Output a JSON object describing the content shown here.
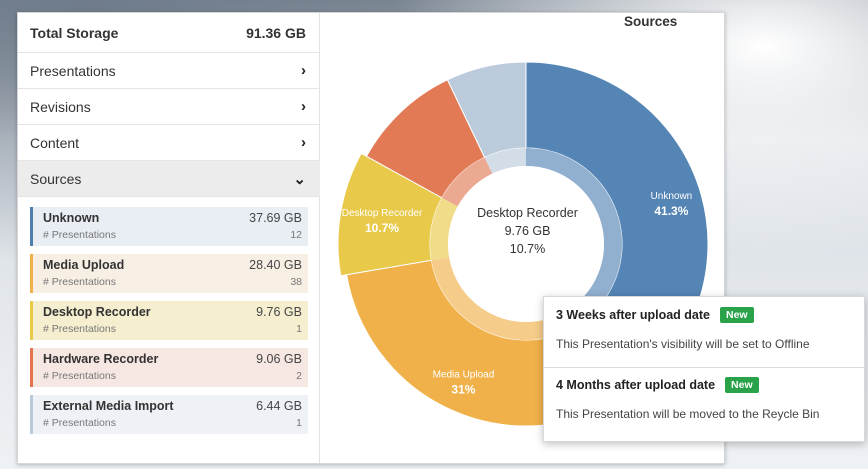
{
  "storage": {
    "total_label": "Total Storage",
    "total_value": "91.36 GB",
    "sections": [
      {
        "label": "Presentations",
        "icon": "chevron-right-icon"
      },
      {
        "label": "Revisions",
        "icon": "chevron-right-icon"
      },
      {
        "label": "Content",
        "icon": "chevron-right-icon"
      },
      {
        "label": "Sources",
        "icon": "chevron-down-icon"
      }
    ],
    "items": [
      {
        "name": "Unknown",
        "value": "37.69 GB",
        "sub_label": "# Presentations",
        "count": "12",
        "color": "#4e7fae",
        "bg": "#e9eef4"
      },
      {
        "name": "Media Upload",
        "value": "28.40 GB",
        "sub_label": "# Presentations",
        "count": "38",
        "color": "#f0b14a",
        "bg": "#f7efe4"
      },
      {
        "name": "Desktop Recorder",
        "value": "9.76 GB",
        "sub_label": "# Presentations",
        "count": "1",
        "color": "#e8c94a",
        "bg": "#f5efcf"
      },
      {
        "name": "Hardware Recorder",
        "value": "9.06 GB",
        "sub_label": "# Presentations",
        "count": "2",
        "color": "#e3744f",
        "bg": "#f7e7e2"
      },
      {
        "name": "External Media Import",
        "value": "6.44 GB",
        "sub_label": "# Presentations",
        "count": "1",
        "color": "#b9cadb",
        "bg": "#eef2f6"
      }
    ]
  },
  "chart_title": "Sources",
  "chart_data": {
    "type": "pie",
    "categories": [
      "Unknown",
      "Media Upload",
      "Desktop Recorder",
      "Hardware Recorder",
      "External Media Import"
    ],
    "values": [
      41.3,
      31,
      10.7,
      9.9,
      7.1
    ],
    "slice_labels": [
      {
        "name": "Unknown",
        "pct": "41.3%"
      },
      {
        "name": "Media Upload",
        "pct": "31%"
      },
      {
        "name": "Desktop Recorder",
        "pct": "10.7%"
      }
    ],
    "colors": [
      "#5585b5",
      "#f0b14a",
      "#e8c94a",
      "#e27a55",
      "#bccbdc"
    ],
    "highlighted": "Desktop Recorder",
    "center": {
      "name": "Desktop Recorder",
      "value": "9.76 GB",
      "pct": "10.7%"
    }
  },
  "tooltip": {
    "sections": [
      {
        "title": "3 Weeks after upload date",
        "badge": "New",
        "body": "This Presentation's visibility will be set to Offline"
      },
      {
        "title": "4 Months after upload date",
        "badge": "New",
        "body": "This Presentation will be moved to the Reycle Bin"
      }
    ]
  }
}
